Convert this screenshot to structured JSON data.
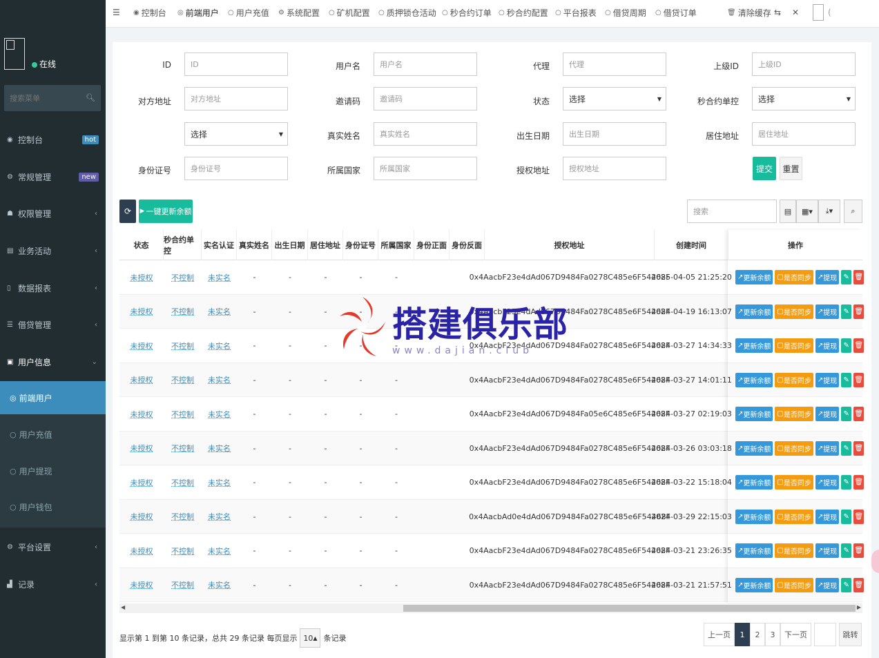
{
  "sidebar": {
    "online_label": "在线",
    "search_placeholder": "搜索菜单",
    "items": [
      {
        "label": "控制台",
        "badge": "hot"
      },
      {
        "label": "常规管理",
        "badge": "new"
      },
      {
        "label": "权限管理"
      },
      {
        "label": "业务活动"
      },
      {
        "label": "数据报表"
      },
      {
        "label": "借贷管理"
      },
      {
        "label": "用户信息"
      },
      {
        "label": "平台设置"
      },
      {
        "label": "记录"
      }
    ],
    "subitems": [
      {
        "label": "前端用户"
      },
      {
        "label": "用户充值"
      },
      {
        "label": "用户提现"
      },
      {
        "label": "用户钱包"
      }
    ]
  },
  "topbar": {
    "tabs": [
      "控制台",
      "前端用户",
      "用户充值",
      "系统配置",
      "矿机配置",
      "质押锁仓活动",
      "秒合约订单",
      "秒合约配置",
      "平台报表",
      "借贷周期",
      "借贷订单"
    ],
    "clear_cache": "清除缓存"
  },
  "filters": {
    "labels": {
      "id": "ID",
      "username": "用户名",
      "agent": "代理",
      "parent_id": "上级ID",
      "peer_address": "对方地址",
      "invite_code": "邀请码",
      "status": "状态",
      "contract_control": "秒合约单控",
      "real_name": "真实姓名",
      "birth_date": "出生日期",
      "residence": "居住地址",
      "id_number": "身份证号",
      "country": "所属国家",
      "auth_address": "授权地址"
    },
    "placeholders": {
      "id": "ID",
      "username": "用户名",
      "agent": "代理",
      "parent_id": "上级ID",
      "peer_address": "对方地址",
      "invite_code": "邀请码",
      "real_name": "真实姓名",
      "birth_date": "出生日期",
      "residence": "居住地址",
      "id_number": "身份证号",
      "country": "所属国家",
      "auth_address": "授权地址"
    },
    "select_label": "选择",
    "submit": "提交",
    "reset": "重置"
  },
  "toolbar": {
    "update_all": "一键更新余额",
    "search_placeholder": "搜索"
  },
  "table": {
    "columns": [
      "状态",
      "秒合约单控",
      "实名认证",
      "真实姓名",
      "出生日期",
      "居住地址",
      "身份证号",
      "所属国家",
      "身份正面",
      "身份反面",
      "授权地址",
      "创建时间",
      "操作"
    ],
    "rows": [
      {
        "status": "未授权",
        "control": "不控制",
        "realname_auth": "未实名",
        "name": "-",
        "birth": "-",
        "addr": "-",
        "idnum": "-",
        "country": "-",
        "front": "",
        "back": "",
        "auth_address": "0x4AacbF23e4dAd067D9484Fa0278C485e6F54468F",
        "created": "2025-04-05 21:25:20"
      },
      {
        "status": "未授权",
        "control": "不控制",
        "realname_auth": "未实名",
        "name": "-",
        "birth": "-",
        "addr": "-",
        "idnum": "-",
        "country": "-",
        "front": "",
        "back": "",
        "auth_address": "0x4AacbF23e4dAd067D9484Fa0278C485e6F54468F",
        "created": "2024-04-19 16:13:07"
      },
      {
        "status": "未授权",
        "control": "不控制",
        "realname_auth": "未实名",
        "name": "-",
        "birth": "-",
        "addr": "-",
        "idnum": "-",
        "country": "-",
        "front": "",
        "back": "",
        "auth_address": "0x4AacbF23e4dAd067D9484Fa0278C485e6F54468F",
        "created": "2024-03-27 14:34:33"
      },
      {
        "status": "未授权",
        "control": "不控制",
        "realname_auth": "未实名",
        "name": "-",
        "birth": "-",
        "addr": "-",
        "idnum": "-",
        "country": "-",
        "front": "",
        "back": "",
        "auth_address": "0x4AacbF23e4dAd067D9484Fa0278C485e6F54468F",
        "created": "2024-03-27 14:01:11"
      },
      {
        "status": "未授权",
        "control": "不控制",
        "realname_auth": "未实名",
        "name": "-",
        "birth": "-",
        "addr": "-",
        "idnum": "-",
        "country": "-",
        "front": "",
        "back": "",
        "auth_address": "0x4AacbF23e4dAd067D9484Fa05e6C485e6F54468F",
        "created": "2024-03-27 02:19:03"
      },
      {
        "status": "未授权",
        "control": "不控制",
        "realname_auth": "未实名",
        "name": "-",
        "birth": "-",
        "addr": "-",
        "idnum": "-",
        "country": "-",
        "front": "",
        "back": "",
        "auth_address": "0x4AacbF23e4dAd067D9484Fa0278C485e6F54468F",
        "created": "2024-03-26 03:03:18"
      },
      {
        "status": "未授权",
        "control": "不控制",
        "realname_auth": "未实名",
        "name": "-",
        "birth": "-",
        "addr": "-",
        "idnum": "-",
        "country": "-",
        "front": "",
        "back": "",
        "auth_address": "0x4AacbF23e4dAd067D9484Fa0278C485e6F54468F",
        "created": "2024-03-22 15:18:04"
      },
      {
        "status": "未授权",
        "control": "不控制",
        "realname_auth": "未实名",
        "name": "-",
        "birth": "-",
        "addr": "-",
        "idnum": "-",
        "country": "-",
        "front": "",
        "back": "",
        "auth_address": "0x4AacbAd0e4dAd067D9484Fa0278C485e6F54468F",
        "created": "2024-03-29 22:15:03"
      },
      {
        "status": "未授权",
        "control": "不控制",
        "realname_auth": "未实名",
        "name": "-",
        "birth": "-",
        "addr": "-",
        "idnum": "-",
        "country": "-",
        "front": "",
        "back": "",
        "auth_address": "0x4AacbF23e4dAd067D9484Fa0278C485e6F54468F",
        "created": "2024-03-21 23:26:35"
      },
      {
        "status": "未授权",
        "control": "不控制",
        "realname_auth": "未实名",
        "name": "-",
        "birth": "-",
        "addr": "-",
        "idnum": "-",
        "country": "-",
        "front": "",
        "back": "",
        "auth_address": "0x4AacbF23e4dAd067D9484Fa0278C485e6F54468F",
        "created": "2024-03-21 21:57:51"
      }
    ],
    "actions": {
      "update_balance": "更新余额",
      "sync": "是否同步",
      "withdraw": "提现",
      "edit_icon": "pencil-icon",
      "delete_icon": "trash-icon"
    }
  },
  "pagination": {
    "info_prefix": "显示第 1 到第 10 条记录，总共 29 条记录 每页显示",
    "page_size": "10",
    "info_suffix": "条记录",
    "prev": "上一页",
    "pages": [
      "1",
      "2",
      "3"
    ],
    "next": "下一页",
    "jump": "跳转"
  },
  "watermark": {
    "text": "搭建俱乐部",
    "url": "www.dajian.club"
  },
  "colors": {
    "sidebar_bg": "#222d32",
    "active_menu": "#3c8dbc",
    "submit_green": "#18bc9c",
    "link_blue": "#3c8dbc",
    "action_blue": "#3498db",
    "action_orange": "#f39c12",
    "action_red": "#e74c3c"
  }
}
